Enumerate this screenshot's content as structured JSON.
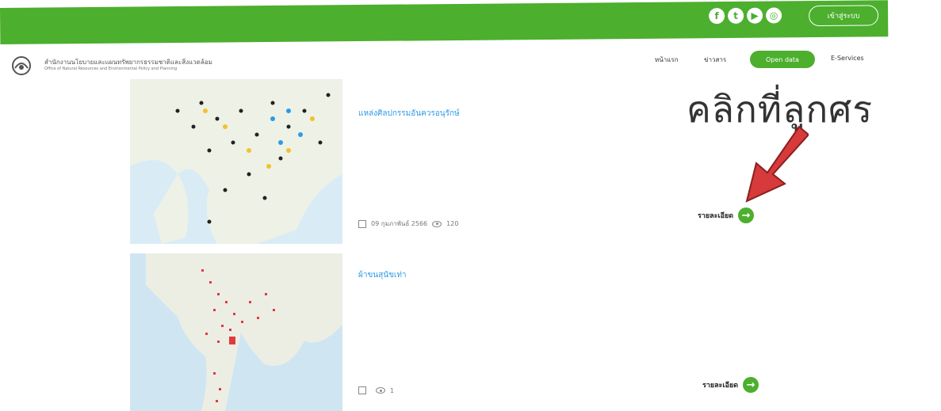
{
  "topbar": {
    "social": [
      {
        "icon": "facebook-icon",
        "glyph": "f"
      },
      {
        "icon": "twitter-icon",
        "glyph": "t"
      },
      {
        "icon": "youtube-icon",
        "glyph": "▶"
      },
      {
        "icon": "instagram-icon",
        "glyph": "◎"
      }
    ],
    "login_label": "เข้าสู่ระบบ"
  },
  "header": {
    "org_name": "สำนักงานนโยบายและแผนทรัพยากรธรรมชาติและสิ่งแวดล้อม",
    "org_subtitle": "Office of Natural Resources and Environmental Policy and Planning",
    "nav": {
      "home": "หน้าแรก",
      "news": "ข่าวสาร",
      "open_data": "Open data",
      "eservices": "E-Services"
    }
  },
  "items": [
    {
      "title": "แหล่งศิลปกรรมอันควรอนุรักษ์",
      "date": "09 กุมภาพันธ์ 2566",
      "views": "120",
      "detail_label": "รายละเอียด"
    },
    {
      "title": "ผ้าขนสุนัขเท่า",
      "date": "",
      "views": "1",
      "detail_label": "รายละเอียด"
    }
  ],
  "annotation": {
    "text": "คลิกที่ลูกศร",
    "arrow_color": "#d63a3a"
  },
  "colors": {
    "brand_green": "#4caf2e",
    "title_blue": "#2e9be6"
  }
}
